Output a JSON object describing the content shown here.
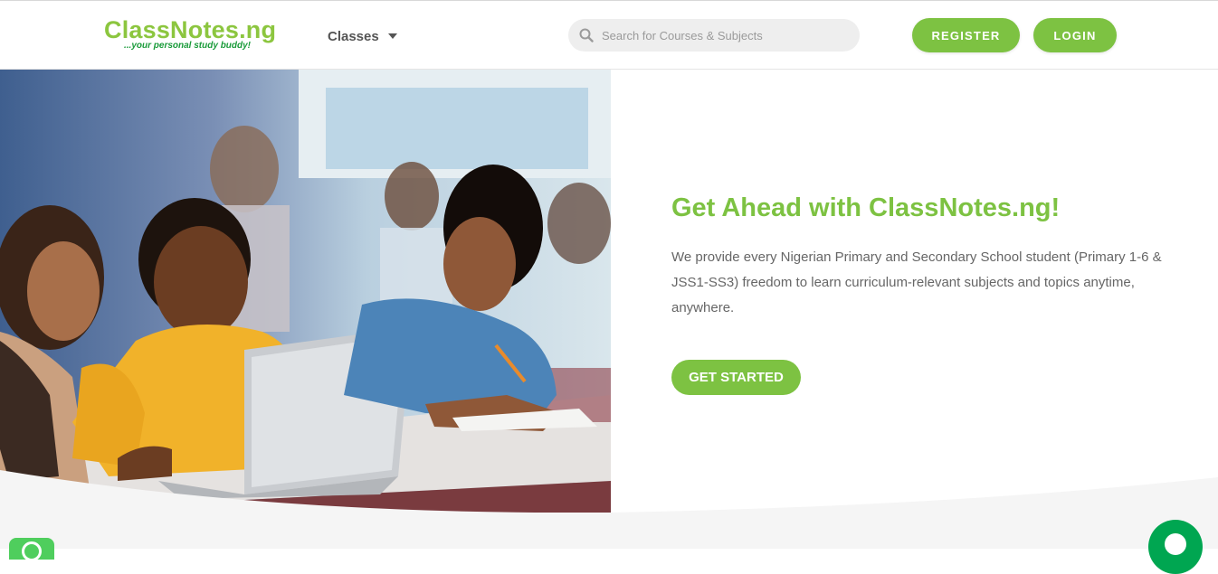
{
  "header": {
    "logo_text": "ClassNotes.ng",
    "logo_tagline": "...your personal study buddy!",
    "classes_label": "Classes",
    "search_placeholder": "Search for Courses & Subjects",
    "register_label": "REGISTER",
    "login_label": "LOGIN"
  },
  "hero": {
    "title": "Get Ahead with ClassNotes.ng!",
    "description": "We provide every Nigerian Primary and Secondary School student (Primary 1-6 & JSS1-SS3) freedom to learn curriculum-relevant subjects and topics anytime, anywhere.",
    "cta_label": "GET STARTED"
  },
  "icons": {
    "search": "search-icon",
    "dropdown": "chevron-down-icon",
    "whatsapp": "whatsapp-icon",
    "chat": "chat-icon"
  },
  "colors": {
    "brand_green": "#7dc242",
    "tagline_green": "#1a9b3a",
    "chat_green": "#00a651"
  }
}
